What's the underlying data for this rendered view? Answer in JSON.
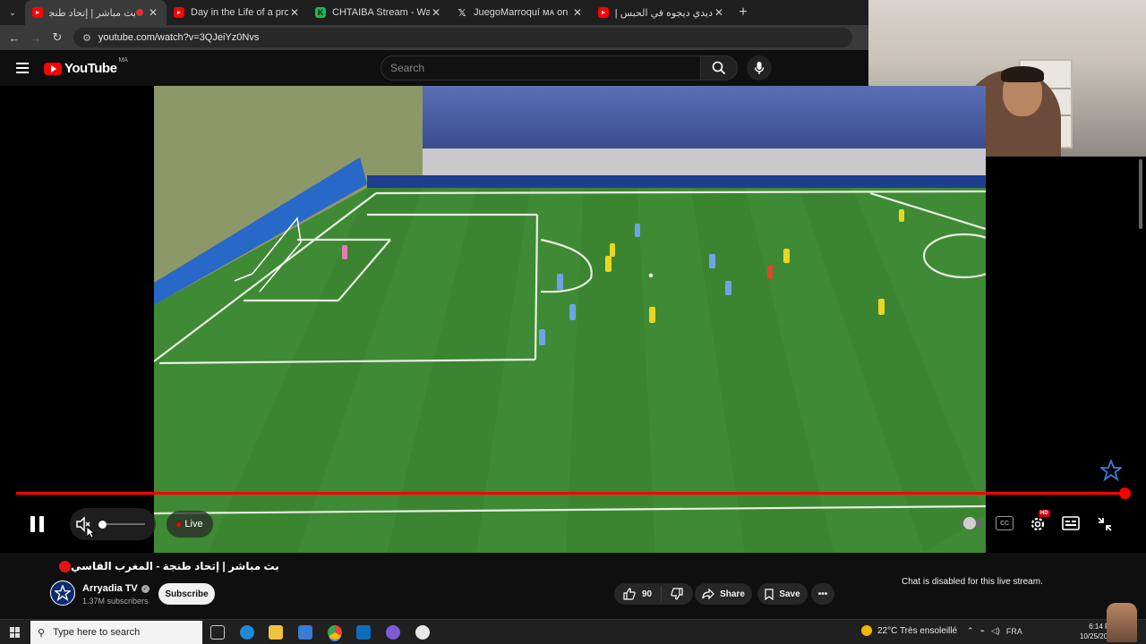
{
  "browser": {
    "tabs": [
      {
        "title": "بث مباشر | إتحاد طنجة - المغ",
        "icon": "youtube-icon",
        "active": true
      },
      {
        "title": "Day in the Life of a pro football",
        "icon": "youtube-icon",
        "active": false
      },
      {
        "title": "CHTAIBA Stream - Watch Live c",
        "icon": "kick-icon",
        "active": false
      },
      {
        "title": "JuegoMarroquí ᴍᴀ on X: \"Azze",
        "icon": "x-icon",
        "active": false
      },
      {
        "title": "ديدي ديجوه في الحبس | بتث كان",
        "icon": "youtube-icon",
        "active": false
      }
    ],
    "url": "youtube.com/watch?v=3QJeiYz0Nvs"
  },
  "youtube": {
    "logo_text": "YouTube",
    "country_code": "MA",
    "search_placeholder": "Search"
  },
  "player": {
    "live_label": "Live",
    "hd_badge": "HD",
    "cc_label": "CC",
    "progress_fraction": 1.0,
    "volume_fraction": 0.0,
    "muted": true,
    "colors": {
      "progress": "#ff0000",
      "pitch": "#3f8a34"
    }
  },
  "video": {
    "title": "بث مباشر | إتحاد طنجة - المغرب الفاسي",
    "channel": "Arryadia TV",
    "subscribers": "1.37M subscribers",
    "subscribe_label": "Subscribe",
    "likes": "90",
    "share_label": "Share",
    "save_label": "Save"
  },
  "chat": {
    "message": "Chat is disabled for this live stream."
  },
  "taskbar": {
    "search_placeholder": "Type here to search",
    "weather": "22°C  Très ensoleillé",
    "language": "FRA",
    "time": "6:14 PM",
    "date": "10/25/2024"
  }
}
